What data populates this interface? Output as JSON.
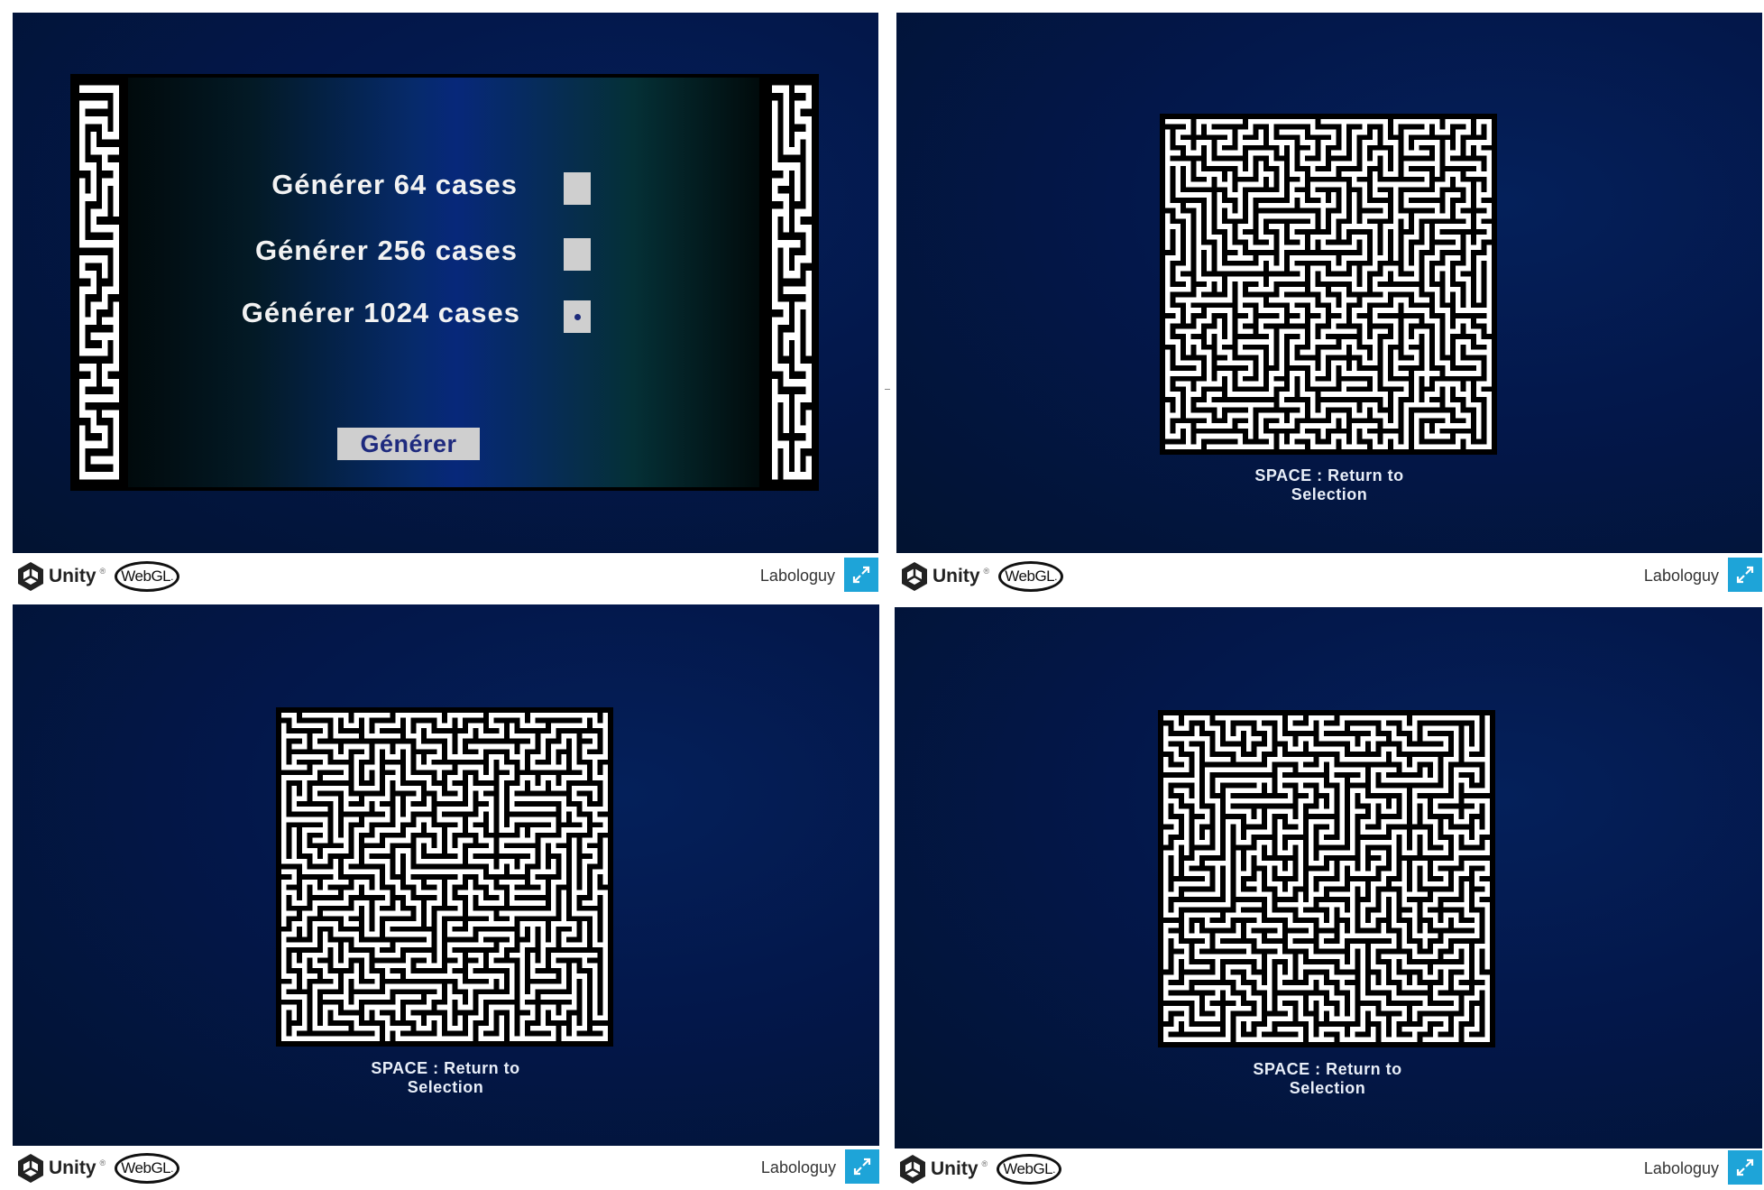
{
  "menu": {
    "options": [
      {
        "label": "Générer 64 cases",
        "selected": false
      },
      {
        "label": "Générer 256 cases",
        "selected": false
      },
      {
        "label": "Générer 1024 cases",
        "selected": true
      }
    ],
    "generate_button": "Générer"
  },
  "views": [
    {
      "hint": "SPACE : Return to\nSelection"
    },
    {
      "hint": "SPACE : Return to\nSelection"
    },
    {
      "hint": "SPACE : Return to\nSelection"
    }
  ],
  "footer": {
    "unity": "Unity",
    "unity_tm": "®",
    "webgl": "WebGL",
    "publisher": "Labologuy"
  },
  "colors": {
    "footer_button": "#1ea4d8",
    "canvas_blue": "#03174a",
    "maze_wall": "#000000",
    "maze_path": "#ffffff"
  },
  "icons": {
    "unity": "unity-cube-icon",
    "fullscreen": "expand-arrows-icon"
  }
}
